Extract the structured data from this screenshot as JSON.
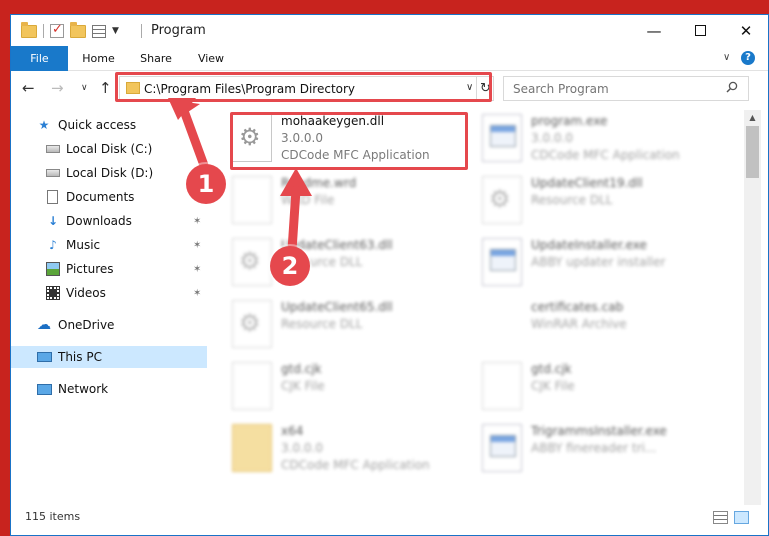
{
  "window": {
    "title": "Program",
    "controls": {
      "minimize": "—",
      "maximize": "",
      "close": "✕"
    }
  },
  "ribbon": {
    "tabs": [
      "File",
      "Home",
      "Share",
      "View"
    ],
    "expand_glyph": "∨",
    "help_glyph": "?"
  },
  "navbar": {
    "back": "←",
    "forward": "→",
    "recent": "∨",
    "up": "↑",
    "address": "C:\\Program Files\\Program Directory",
    "address_dropdown": "∨",
    "refresh": "↻",
    "search_placeholder": "Search Program"
  },
  "sidebar": {
    "items": [
      {
        "label": "Quick access",
        "icon": "star-icon",
        "glyph": "★",
        "pinned": false
      },
      {
        "label": "Local Disk (C:)",
        "icon": "disk-icon",
        "glyph": "",
        "pinned": true
      },
      {
        "label": "Local Disk (D:)",
        "icon": "disk-icon",
        "glyph": "",
        "pinned": true
      },
      {
        "label": "Documents",
        "icon": "documents-icon",
        "glyph": "",
        "pinned": true
      },
      {
        "label": "Downloads",
        "icon": "downloads-icon",
        "glyph": "↓",
        "pinned": true
      },
      {
        "label": "Music",
        "icon": "music-icon",
        "glyph": "♪",
        "pinned": true
      },
      {
        "label": "Pictures",
        "icon": "pictures-icon",
        "glyph": "",
        "pinned": true
      },
      {
        "label": "Videos",
        "icon": "videos-icon",
        "glyph": "",
        "pinned": true
      },
      {
        "label": "OneDrive",
        "icon": "cloud-icon",
        "glyph": "☁",
        "pinned": false
      },
      {
        "label": "This PC",
        "icon": "pc-icon",
        "glyph": "",
        "pinned": false
      },
      {
        "label": "Network",
        "icon": "network-icon",
        "glyph": "",
        "pinned": false
      }
    ],
    "pin_glyph": "✶"
  },
  "files": [
    {
      "name": "mohaakeygen.dll",
      "line1": "3.0.0.0",
      "line2": "CDCode MFC Application",
      "kind": "gear",
      "highlighted": true
    },
    {
      "name": "program.exe",
      "line1": "3.0.0.0",
      "line2": "CDCode MFC Application",
      "kind": "exe",
      "highlighted": false
    },
    {
      "name": "Readme.wrd",
      "line1": "WRD File",
      "line2": "",
      "kind": "doc",
      "highlighted": false
    },
    {
      "name": "UpdateClient19.dll",
      "line1": "Resource DLL",
      "line2": "",
      "kind": "gear",
      "highlighted": false
    },
    {
      "name": "UpdateClient63.dll",
      "line1": "Resource DLL",
      "line2": "",
      "kind": "gear",
      "highlighted": false
    },
    {
      "name": "UpdateInstaller.exe",
      "line1": "ABBY updater installer",
      "line2": "",
      "kind": "exe",
      "highlighted": false
    },
    {
      "name": "UpdateClient65.dll",
      "line1": "Resource DLL",
      "line2": "",
      "kind": "gear",
      "highlighted": false
    },
    {
      "name": "certificates.cab",
      "line1": "WinRAR Archive",
      "line2": "",
      "kind": "rar",
      "highlighted": false
    },
    {
      "name": "gtd.cjk",
      "line1": "CJK File",
      "line2": "",
      "kind": "doc",
      "highlighted": false
    },
    {
      "name": "gtd.cjk",
      "line1": "CJK File",
      "line2": "",
      "kind": "doc",
      "highlighted": false
    },
    {
      "name": "x64",
      "line1": "3.0.0.0",
      "line2": "CDCode MFC Application",
      "kind": "folder",
      "highlighted": false
    },
    {
      "name": "TrigrammsInstaller.exe",
      "line1": "ABBY finereader tri...",
      "line2": "",
      "kind": "exe",
      "highlighted": false
    }
  ],
  "status": {
    "count_text": "115 items"
  },
  "annotations": {
    "step1": "1",
    "step2": "2",
    "color": "#e5484d"
  },
  "colors": {
    "accent": "#1979ca",
    "selection": "#cce8ff",
    "highlight": "#e5484d"
  }
}
